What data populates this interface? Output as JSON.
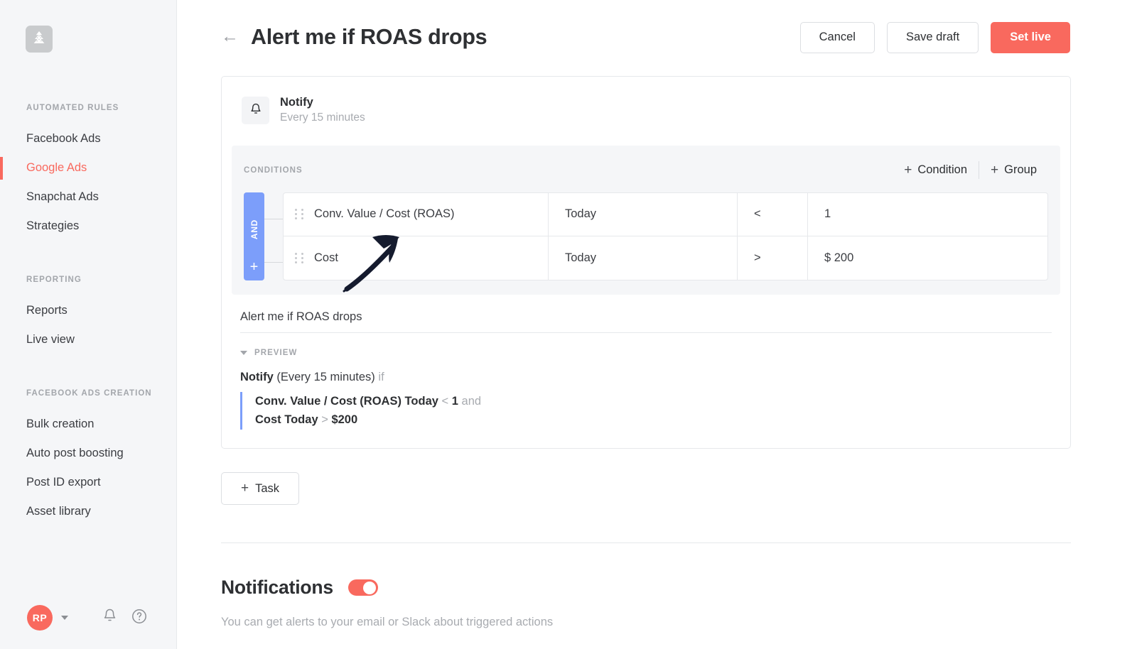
{
  "sidebar": {
    "logo_icon": "tree-logo-icon",
    "sections": [
      {
        "heading": "AUTOMATED RULES",
        "items": [
          {
            "label": "Facebook Ads",
            "active": false
          },
          {
            "label": "Google Ads",
            "active": true
          },
          {
            "label": "Snapchat Ads",
            "active": false
          },
          {
            "label": "Strategies",
            "active": false
          }
        ]
      },
      {
        "heading": "REPORTING",
        "items": [
          {
            "label": "Reports",
            "active": false
          },
          {
            "label": "Live view",
            "active": false
          }
        ]
      },
      {
        "heading": "FACEBOOK ADS CREATION",
        "items": [
          {
            "label": "Bulk creation",
            "active": false
          },
          {
            "label": "Auto post boosting",
            "active": false
          },
          {
            "label": "Post ID export",
            "active": false
          },
          {
            "label": "Asset library",
            "active": false
          }
        ]
      }
    ],
    "footer": {
      "avatar_initials": "RP",
      "caret_icon": "chevron-down-icon",
      "bell_icon": "bell-icon",
      "help_icon": "question-mark-circle-icon"
    }
  },
  "header": {
    "back_icon": "arrow-left-icon",
    "title": "Alert me if ROAS drops",
    "cancel_label": "Cancel",
    "save_draft_label": "Save draft",
    "set_live_label": "Set live"
  },
  "rule": {
    "action_icon": "bell-icon",
    "action_title": "Notify",
    "action_schedule": "Every 15 minutes",
    "conditions_label": "CONDITIONS",
    "add_condition_label": "Condition",
    "add_group_label": "Group",
    "plus_symbol": "+",
    "logic_operator": "AND",
    "rows": [
      {
        "metric": "Conv. Value / Cost (ROAS)",
        "range": "Today",
        "operator": "<",
        "value": "1"
      },
      {
        "metric": "Cost",
        "range": "Today",
        "operator": ">",
        "value": "$ 200"
      }
    ],
    "name_value": "Alert me if ROAS drops",
    "preview_label": "PREVIEW",
    "preview": {
      "action": "Notify",
      "schedule": "(Every 15 minutes)",
      "if_word": "if",
      "lines": [
        {
          "subject": "Conv. Value / Cost (ROAS) Today",
          "operator": "<",
          "value": "1",
          "conjunction": "and"
        },
        {
          "subject": "Cost Today",
          "operator": ">",
          "value": "$200",
          "conjunction": ""
        }
      ]
    },
    "add_task_label": "Task"
  },
  "notifications": {
    "title": "Notifications",
    "toggle_on": true,
    "description": "You can get alerts to your email or Slack about triggered actions"
  },
  "colors": {
    "accent": "#f9695e",
    "logic_blue": "#7c9efa",
    "sidebar_bg": "#f5f6f8",
    "annotation": "#151b2e"
  }
}
